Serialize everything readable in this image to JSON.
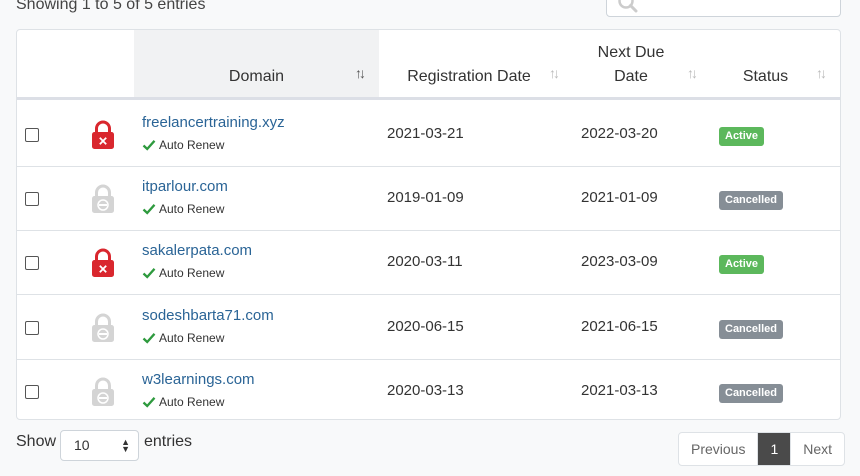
{
  "info": "Showing 1 to 5 of 5 entries",
  "search": {
    "placeholder": ""
  },
  "columns": {
    "domain": "Domain",
    "reg": "Registration Date",
    "due_line1": "Next Due",
    "due_line2": "Date",
    "status": "Status"
  },
  "rows": [
    {
      "domain": "freelancertraining.xyz",
      "renew": "Auto Renew",
      "reg": "2021-03-21",
      "due": "2022-03-20",
      "status": "Active",
      "lock": "locked"
    },
    {
      "domain": "itparlour.com",
      "renew": "Auto Renew",
      "reg": "2019-01-09",
      "due": "2021-01-09",
      "status": "Cancelled",
      "lock": "unlocked"
    },
    {
      "domain": "sakalerpata.com",
      "renew": "Auto Renew",
      "reg": "2020-03-11",
      "due": "2023-03-09",
      "status": "Active",
      "lock": "locked"
    },
    {
      "domain": "sodeshbarta71.com",
      "renew": "Auto Renew",
      "reg": "2020-06-15",
      "due": "2021-06-15",
      "status": "Cancelled",
      "lock": "unlocked"
    },
    {
      "domain": "w3learnings.com",
      "renew": "Auto Renew",
      "reg": "2020-03-13",
      "due": "2021-03-13",
      "status": "Cancelled",
      "lock": "unlocked"
    }
  ],
  "colors": {
    "active": "#5cb85c",
    "cancelled": "#868e96",
    "locked": "#d9272e",
    "unlocked": "#d4d4d4",
    "check": "#2e9a3e",
    "link": "#2a6496"
  },
  "footer": {
    "show": "Show",
    "length_value": "10",
    "entries": "entries",
    "previous": "Previous",
    "page": "1",
    "next": "Next"
  }
}
